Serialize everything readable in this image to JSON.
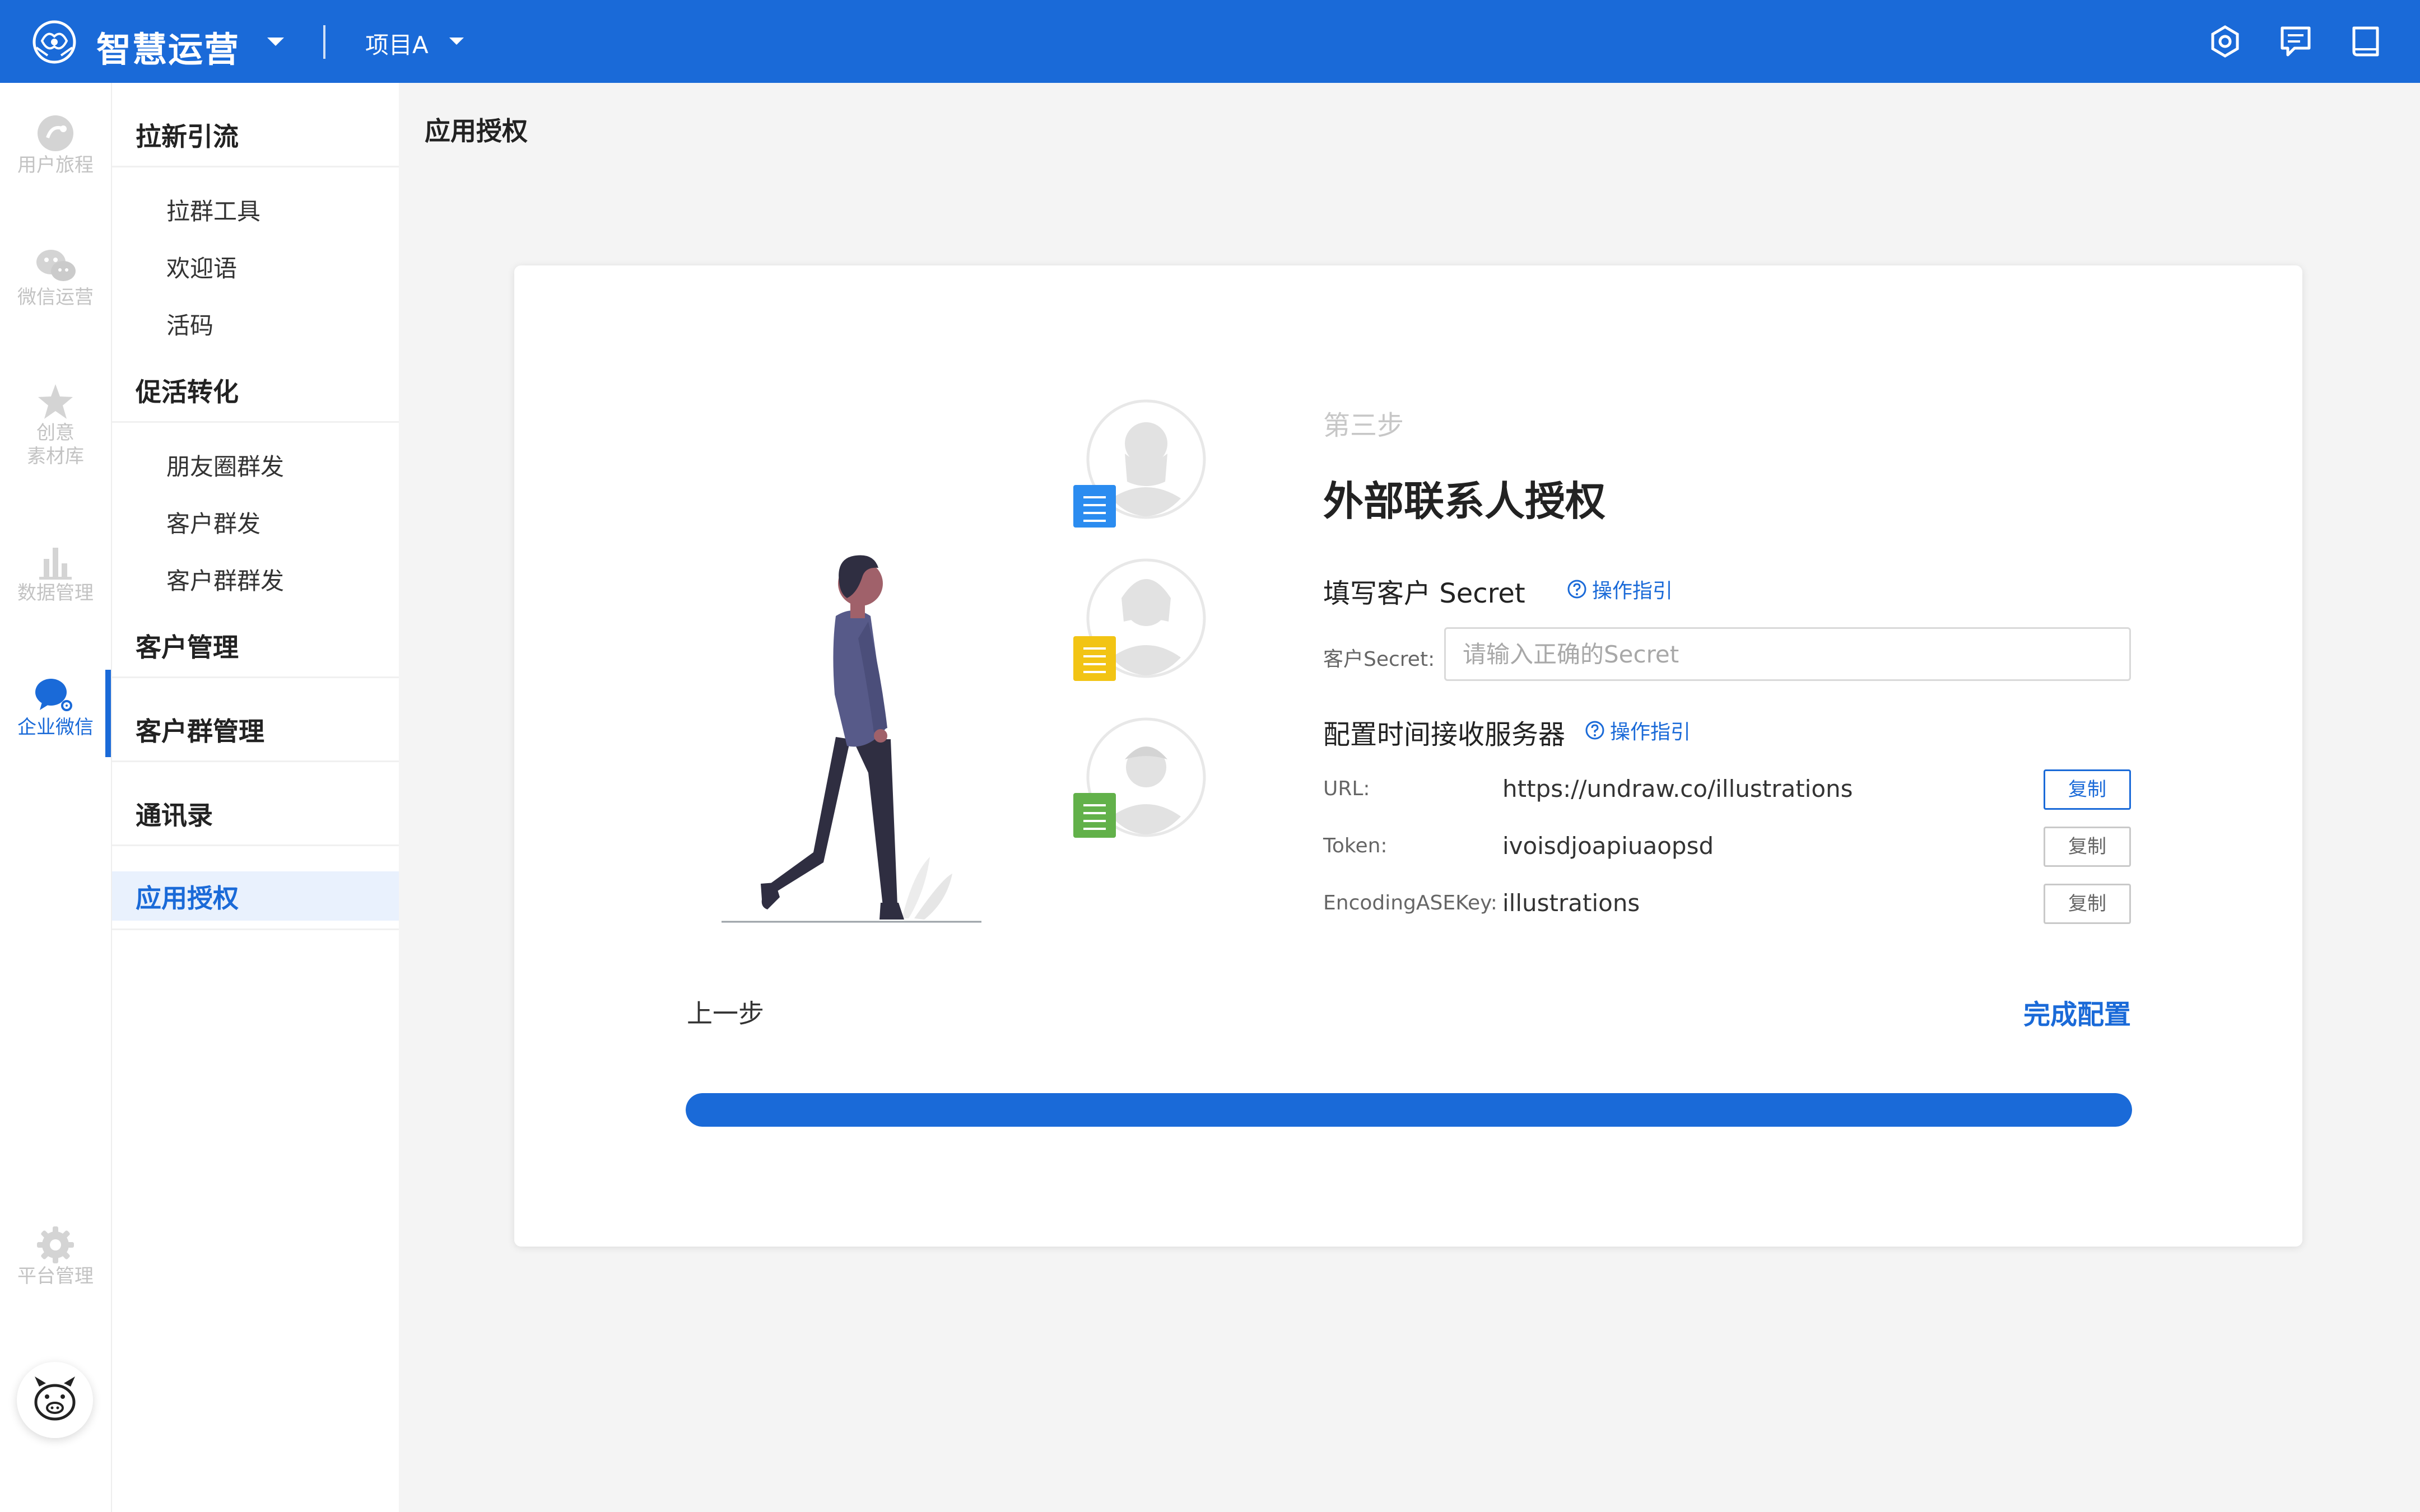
{
  "header": {
    "brand": "智慧运营",
    "project": "项目A",
    "icons": [
      "settings-icon",
      "message-icon",
      "book-icon"
    ]
  },
  "rail": {
    "items": [
      {
        "label": "用户旅程",
        "icon": "journey-icon"
      },
      {
        "label": "微信运营",
        "icon": "wechat-icon"
      },
      {
        "label_line1": "创意",
        "label_line2": "素材库",
        "icon": "star-icon"
      },
      {
        "label": "数据管理",
        "icon": "bar-chart-icon"
      },
      {
        "label": "企业微信",
        "icon": "work-wechat-icon",
        "active": true
      },
      {
        "label": "平台管理",
        "icon": "gear-icon"
      }
    ]
  },
  "menu": {
    "groups": [
      {
        "label": "拉新引流",
        "items": [
          "拉群工具",
          "欢迎语",
          "活码"
        ]
      },
      {
        "label": "促活转化",
        "items": [
          "朋友圈群发",
          "客户群发",
          "客户群群发"
        ]
      },
      {
        "label": "客户管理",
        "items": []
      },
      {
        "label": "客户群管理",
        "items": []
      },
      {
        "label": "通讯录",
        "items": []
      },
      {
        "label": "应用授权",
        "items": [],
        "active": true
      }
    ]
  },
  "page": {
    "title": "应用授权"
  },
  "wizard": {
    "step_label": "第三步",
    "step_title": "外部联系人授权",
    "secret_section": {
      "title": "填写客户 Secret",
      "guide": "操作指引",
      "field_label": "客户Secret:",
      "placeholder": "请输入正确的Secret",
      "value": ""
    },
    "server_section": {
      "title": "配置时间接收服务器",
      "guide": "操作指引",
      "rows": [
        {
          "label": "URL:",
          "value": "https://undraw.co/illustrations",
          "button": "复制"
        },
        {
          "label": "Token:",
          "value": "ivoisdjoapiuaopsd",
          "button": "复制"
        },
        {
          "label": "EncodingASEKey:",
          "value": "illustrations",
          "button": "复制"
        }
      ]
    },
    "prev_label": "上一步",
    "finish_label": "完成配置",
    "progress": 1.0
  },
  "colors": {
    "primary": "#1a6ad8",
    "doc_blue": "#2b8cf0",
    "doc_yellow": "#f2c414",
    "doc_green": "#62b14a"
  }
}
